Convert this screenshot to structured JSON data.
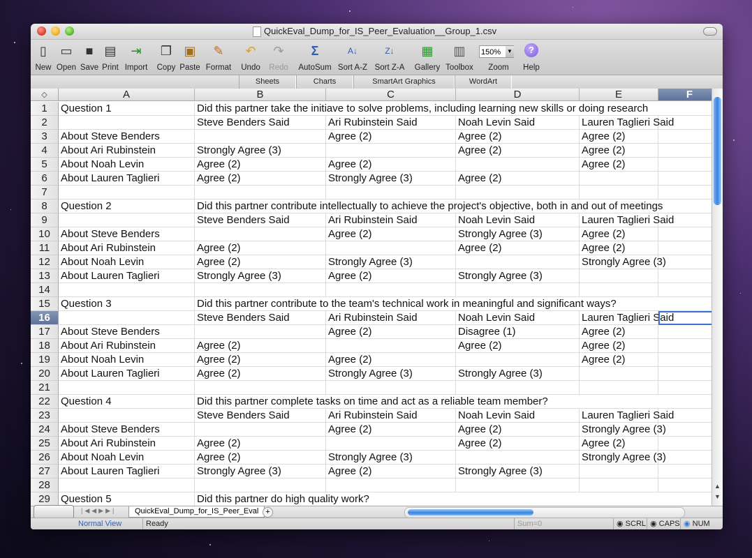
{
  "window": {
    "title": "QuickEval_Dump_for_IS_Peer_Evaluation__Group_1.csv"
  },
  "toolbar": {
    "new": "New",
    "open": "Open",
    "save": "Save",
    "print": "Print",
    "import": "Import",
    "copy": "Copy",
    "paste": "Paste",
    "format": "Format",
    "undo": "Undo",
    "redo": "Redo",
    "autosum": "AutoSum",
    "sort_az": "Sort A-Z",
    "sort_za": "Sort Z-A",
    "gallery": "Gallery",
    "toolbox": "Toolbox",
    "zoom_label": "Zoom",
    "zoom_value": "150%",
    "help": "Help"
  },
  "ribbon_tabs": [
    "Sheets",
    "Charts",
    "SmartArt Graphics",
    "WordArt"
  ],
  "columns": [
    "A",
    "B",
    "C",
    "D",
    "E",
    "F"
  ],
  "selected_column": "F",
  "selected_row": 16,
  "rows": [
    {
      "n": "1",
      "a": "Question 1",
      "b": "Did this partner take the initiave to solve problems, including learning new skills or doing research",
      "c": "",
      "d": "",
      "e": ""
    },
    {
      "n": "2",
      "a": "",
      "b": "Steve Benders Said",
      "c": "Ari Rubinstein Said",
      "d": "Noah Levin Said",
      "e": "Lauren Taglieri Said"
    },
    {
      "n": "3",
      "a": "About Steve Benders",
      "b": "",
      "c": "Agree (2)",
      "d": "Agree (2)",
      "e": "Agree (2)"
    },
    {
      "n": "4",
      "a": "About Ari Rubinstein",
      "b": "Strongly Agree (3)",
      "c": "",
      "d": "Agree (2)",
      "e": "Agree (2)"
    },
    {
      "n": "5",
      "a": "About Noah Levin",
      "b": "Agree (2)",
      "c": "Agree (2)",
      "d": "",
      "e": "Agree (2)"
    },
    {
      "n": "6",
      "a": "About Lauren Taglieri",
      "b": "Agree (2)",
      "c": "Strongly Agree (3)",
      "d": "Agree (2)",
      "e": ""
    },
    {
      "n": "7",
      "a": "",
      "b": "",
      "c": "",
      "d": "",
      "e": ""
    },
    {
      "n": "8",
      "a": "Question 2",
      "b": "Did this partner contribute intellectually to achieve the project's objective, both in and out of meetings",
      "c": "",
      "d": "",
      "e": ""
    },
    {
      "n": "9",
      "a": "",
      "b": "Steve Benders Said",
      "c": "Ari Rubinstein Said",
      "d": "Noah Levin Said",
      "e": "Lauren Taglieri Said"
    },
    {
      "n": "10",
      "a": "About Steve Benders",
      "b": "",
      "c": "Agree (2)",
      "d": "Strongly Agree (3)",
      "e": "Agree (2)"
    },
    {
      "n": "11",
      "a": "About Ari Rubinstein",
      "b": "Agree (2)",
      "c": "",
      "d": "Agree (2)",
      "e": "Agree (2)"
    },
    {
      "n": "12",
      "a": "About Noah Levin",
      "b": "Agree (2)",
      "c": "Strongly Agree (3)",
      "d": "",
      "e": "Strongly Agree (3)"
    },
    {
      "n": "13",
      "a": "About Lauren Taglieri",
      "b": "Strongly Agree (3)",
      "c": "Agree (2)",
      "d": "Strongly Agree (3)",
      "e": ""
    },
    {
      "n": "14",
      "a": "",
      "b": "",
      "c": "",
      "d": "",
      "e": ""
    },
    {
      "n": "15",
      "a": "Question 3",
      "b": "Did this partner contribute to the team's technical work in meaningful and significant ways?",
      "c": "",
      "d": "",
      "e": ""
    },
    {
      "n": "16",
      "a": "",
      "b": "Steve Benders Said",
      "c": "Ari Rubinstein Said",
      "d": "Noah Levin Said",
      "e": "Lauren Taglieri Said"
    },
    {
      "n": "17",
      "a": "About Steve Benders",
      "b": "",
      "c": "Agree (2)",
      "d": "Disagree (1)",
      "e": "Agree (2)"
    },
    {
      "n": "18",
      "a": "About Ari Rubinstein",
      "b": "Agree (2)",
      "c": "",
      "d": "Agree (2)",
      "e": "Agree (2)"
    },
    {
      "n": "19",
      "a": "About Noah Levin",
      "b": "Agree (2)",
      "c": "Agree (2)",
      "d": "",
      "e": "Agree (2)"
    },
    {
      "n": "20",
      "a": "About Lauren Taglieri",
      "b": "Agree (2)",
      "c": "Strongly Agree (3)",
      "d": "Strongly Agree (3)",
      "e": ""
    },
    {
      "n": "21",
      "a": "",
      "b": "",
      "c": "",
      "d": "",
      "e": ""
    },
    {
      "n": "22",
      "a": "Question 4",
      "b": "Did this partner complete tasks on time and act as a reliable team member?",
      "c": "",
      "d": "",
      "e": ""
    },
    {
      "n": "23",
      "a": "",
      "b": "Steve Benders Said",
      "c": "Ari Rubinstein Said",
      "d": "Noah Levin Said",
      "e": "Lauren Taglieri Said"
    },
    {
      "n": "24",
      "a": "About Steve Benders",
      "b": "",
      "c": "Agree (2)",
      "d": "Agree (2)",
      "e": "Strongly Agree (3)"
    },
    {
      "n": "25",
      "a": "About Ari Rubinstein",
      "b": "Agree (2)",
      "c": "",
      "d": "Agree (2)",
      "e": "Agree (2)"
    },
    {
      "n": "26",
      "a": "About Noah Levin",
      "b": "Agree (2)",
      "c": "Strongly Agree (3)",
      "d": "",
      "e": "Strongly Agree (3)"
    },
    {
      "n": "27",
      "a": "About Lauren Taglieri",
      "b": "Strongly Agree (3)",
      "c": "Agree (2)",
      "d": "Strongly Agree (3)",
      "e": ""
    },
    {
      "n": "28",
      "a": "",
      "b": "",
      "c": "",
      "d": "",
      "e": ""
    },
    {
      "n": "29",
      "a": "Question 5",
      "b": "Did this partner do high quality work?",
      "c": "",
      "d": "",
      "e": ""
    }
  ],
  "sheet_tab": "QuickEval_Dump_for_IS_Peer_Eval",
  "status": {
    "view": "Normal View",
    "state": "Ready",
    "sum": "Sum=0",
    "scrl": "SCRL",
    "caps": "CAPS",
    "num": "NUM"
  }
}
